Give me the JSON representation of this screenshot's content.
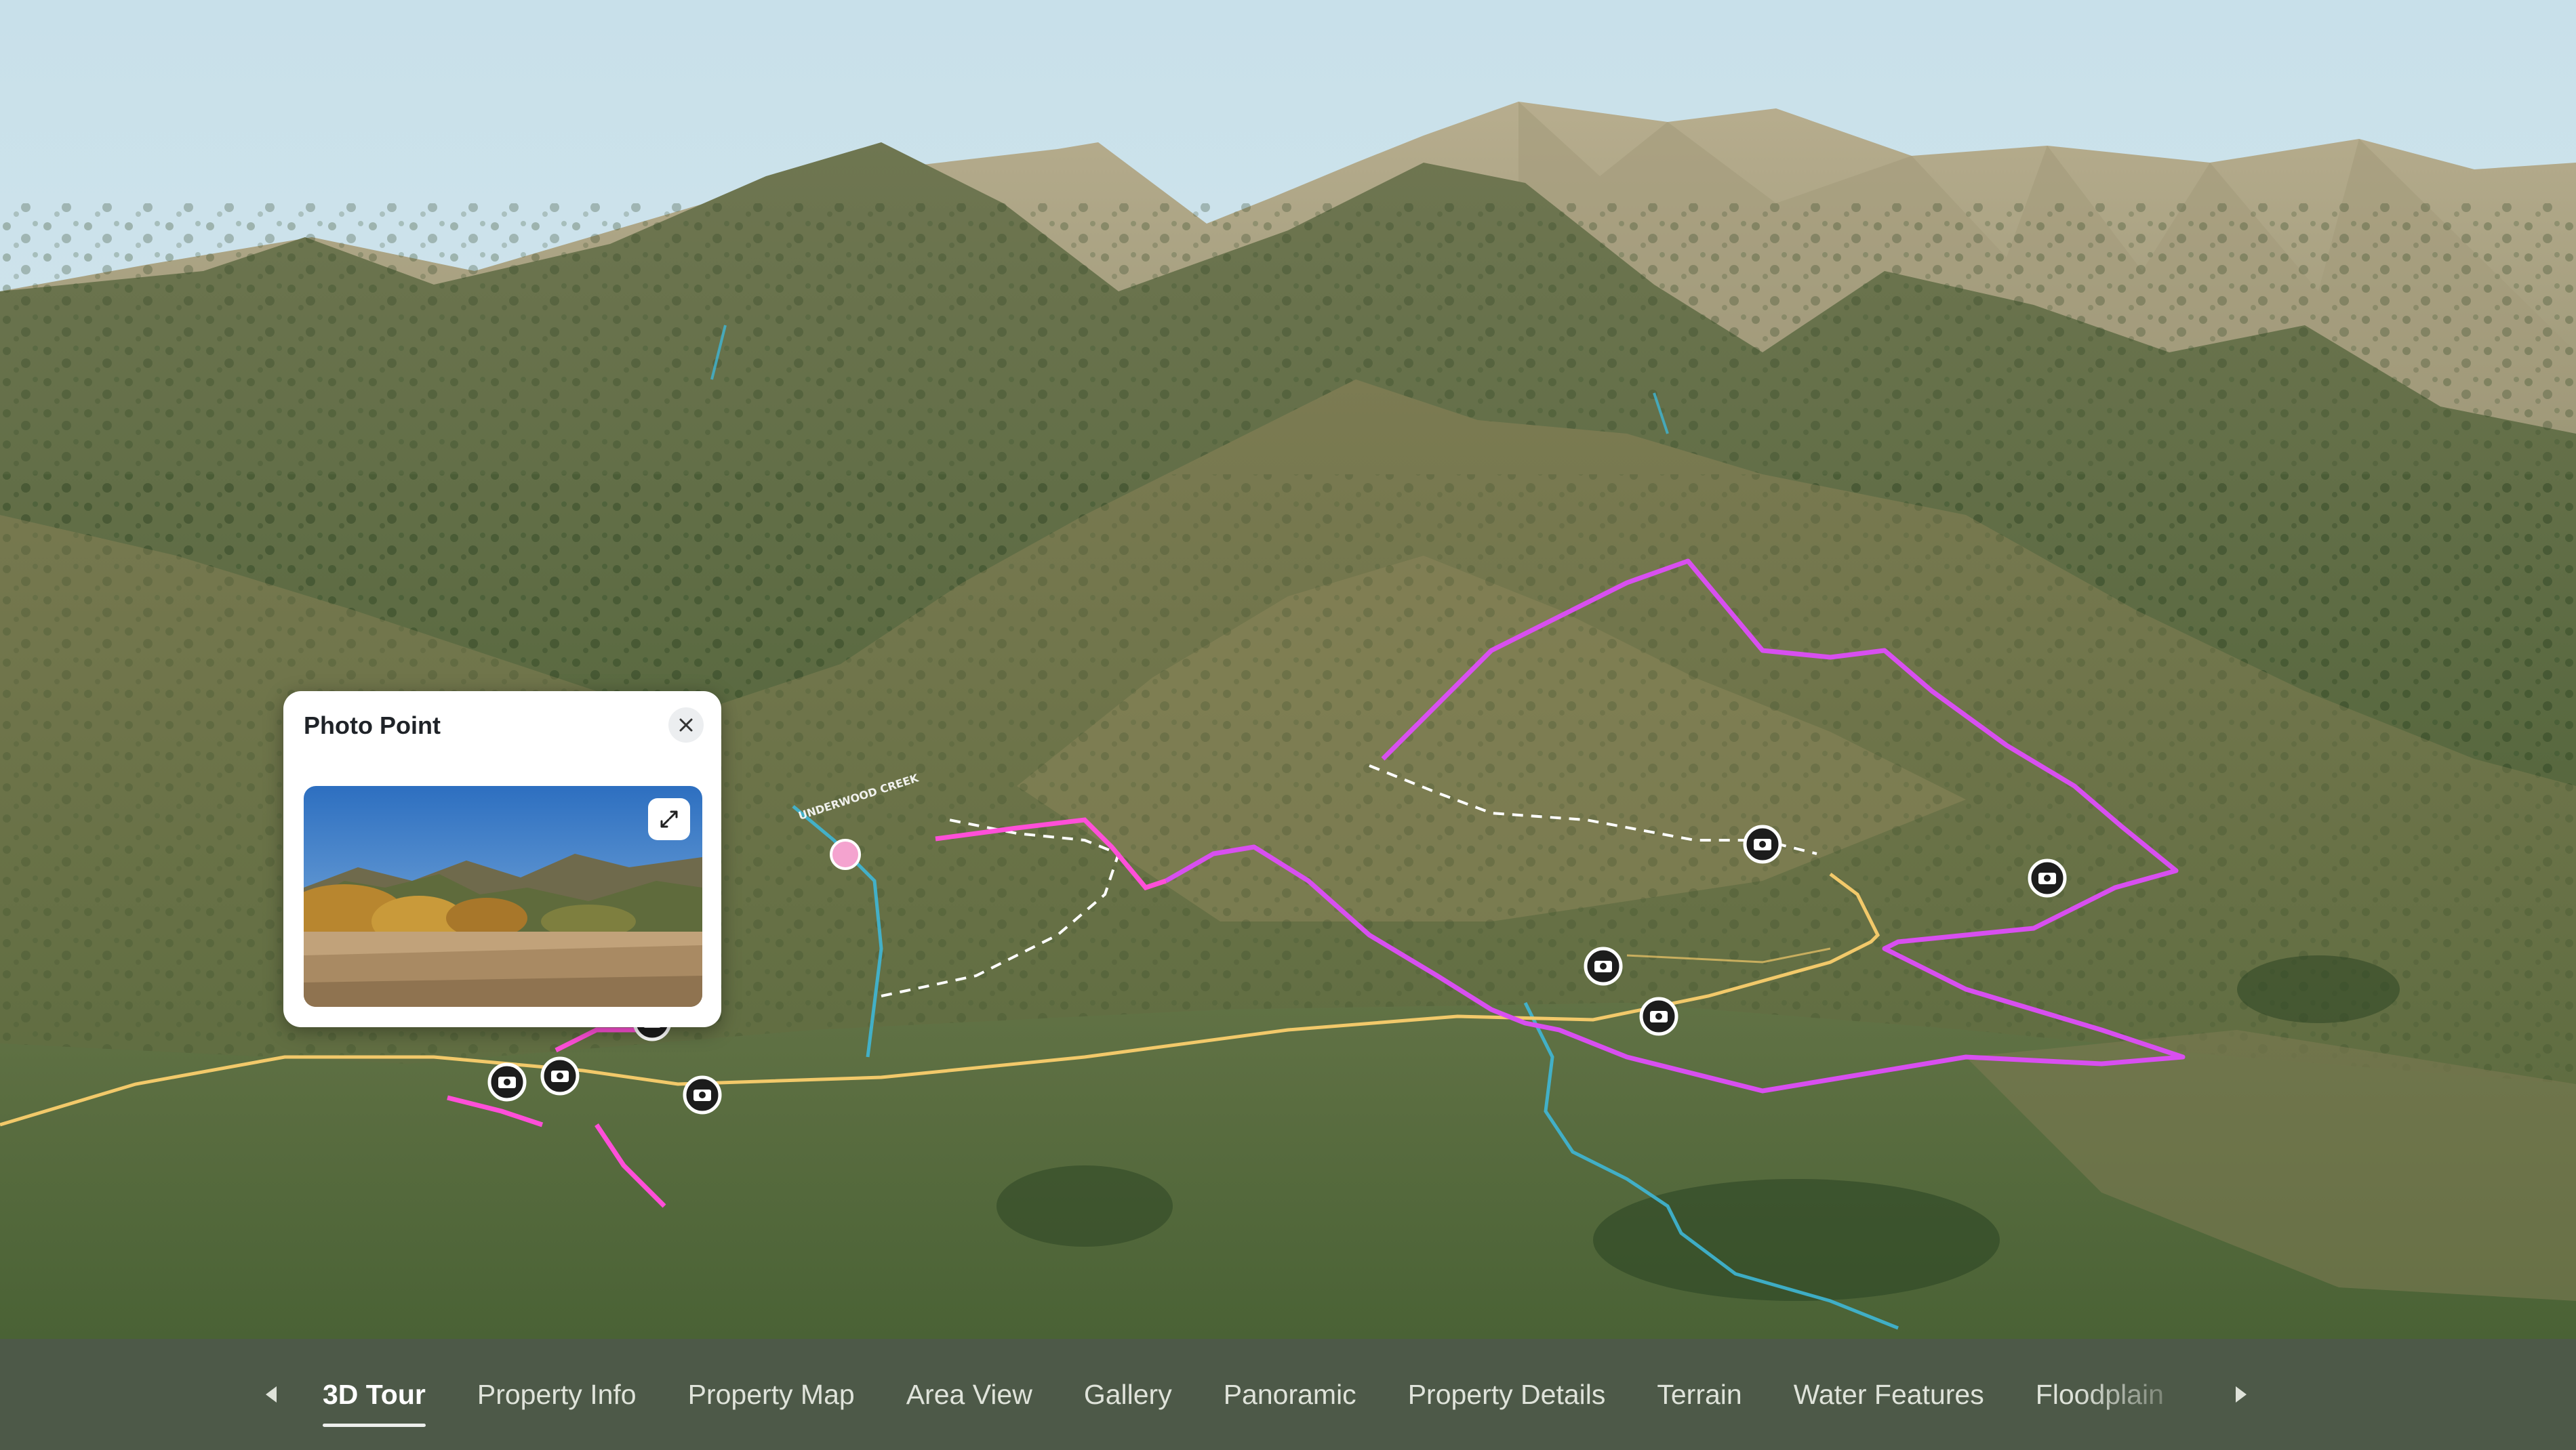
{
  "popup": {
    "title": "Photo Point",
    "close_icon": "close-icon",
    "expand_icon": "expand-icon"
  },
  "map": {
    "creek_label": "UNDERWOOD CREEK",
    "colors": {
      "boundary": "#d84ff0",
      "road": "#f2c96a",
      "creek": "#3fb7d6",
      "trail": "#ffffff",
      "pink_route": "#ff4fd8",
      "sky": "#cfe3ea"
    },
    "photo_points": [
      "camera-icon",
      "camera-icon",
      "camera-icon",
      "camera-icon",
      "camera-icon",
      "camera-icon",
      "camera-icon",
      "camera-icon"
    ]
  },
  "nav": {
    "prev_icon": "chevron-left-icon",
    "next_icon": "chevron-right-icon",
    "tabs": [
      {
        "label": "3D Tour",
        "active": true
      },
      {
        "label": "Property Info"
      },
      {
        "label": "Property Map"
      },
      {
        "label": "Area View"
      },
      {
        "label": "Gallery"
      },
      {
        "label": "Panoramic"
      },
      {
        "label": "Property Details"
      },
      {
        "label": "Terrain"
      },
      {
        "label": "Water Features"
      },
      {
        "label": "Floodplain"
      }
    ]
  }
}
